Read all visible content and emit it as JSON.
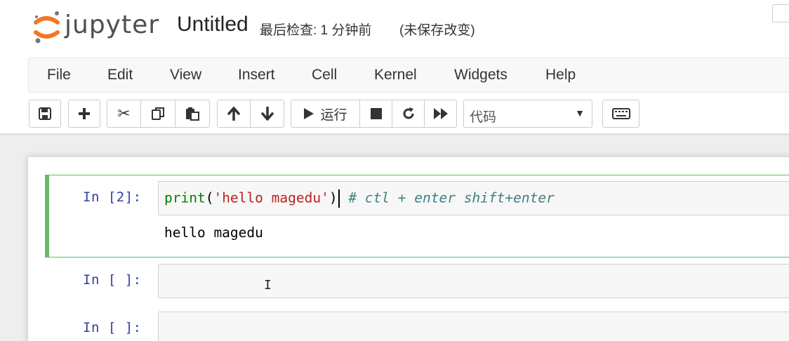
{
  "header": {
    "logo_text": "jupyter",
    "notebook_name": "Untitled",
    "checkpoint": "最后检查: 1 分钟前",
    "save_status": "(未保存改变)",
    "logo_colors": {
      "orange": "#f37726",
      "gray": "#767677"
    }
  },
  "menu": [
    {
      "label": "File"
    },
    {
      "label": "Edit"
    },
    {
      "label": "View"
    },
    {
      "label": "Insert"
    },
    {
      "label": "Cell"
    },
    {
      "label": "Kernel"
    },
    {
      "label": "Widgets"
    },
    {
      "label": "Help"
    }
  ],
  "toolbar": {
    "icons": [
      "save-icon",
      "plus-icon",
      "scissors-icon",
      "copy-icon",
      "paste-icon",
      "arrow-up-icon",
      "arrow-down-icon",
      "play-icon",
      "stop-icon",
      "restart-icon",
      "fast-forward-icon",
      "keyboard-icon"
    ],
    "run_label": "运行",
    "cell_type": "代码"
  },
  "cells": [
    {
      "prompt": "In [2]:",
      "code": {
        "builtin": "print",
        "open_paren": "(",
        "string": "'hello magedu'",
        "close_paren": ")",
        "comment": "# ctl + enter shift+enter"
      },
      "output": "hello magedu",
      "selected": true,
      "mode_color": "#66bb6a"
    },
    {
      "prompt": "In [ ]:",
      "code": ""
    },
    {
      "prompt": "In [ ]:",
      "code": ""
    }
  ],
  "colors": {
    "prompt": "#303f9f",
    "selected_border": "#66bb6a",
    "string": "#ba2121",
    "builtin": "#008000",
    "comment": "#408080"
  }
}
